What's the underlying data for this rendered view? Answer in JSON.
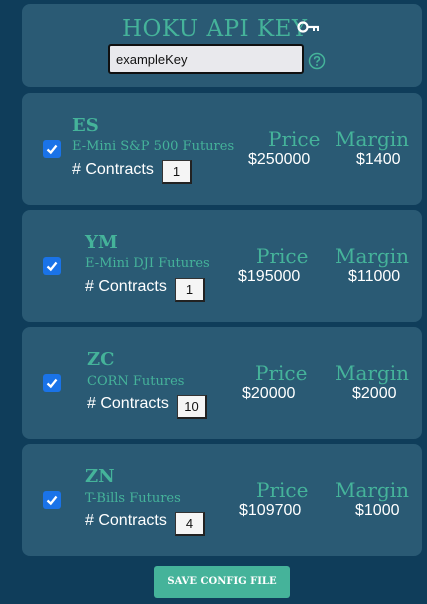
{
  "api": {
    "title": "HOKU API KEY",
    "key_value": "exampleKey",
    "key_icon": "key-icon",
    "help_icon": "help-circle-icon"
  },
  "labels": {
    "contracts": "# Contracts",
    "price": "Price",
    "margin": "Margin"
  },
  "futures": [
    {
      "checked": true,
      "ticker": "ES",
      "name": "E-Mini S&P 500 Futures",
      "contracts": "1",
      "price": "$250000",
      "margin": "$1400"
    },
    {
      "checked": true,
      "ticker": "YM",
      "name": "E-Mini DJI Futures",
      "contracts": "1",
      "price": "$195000",
      "margin": "$11000"
    },
    {
      "checked": true,
      "ticker": "ZC",
      "name": "CORN Futures",
      "contracts": "10",
      "price": "$20000",
      "margin": "$2000"
    },
    {
      "checked": true,
      "ticker": "ZN",
      "name": "T-Bills Futures",
      "contracts": "4",
      "price": "$109700",
      "margin": "$1000"
    }
  ],
  "save_label": "SAVE CONFIG FILE",
  "colors": {
    "background": "#0f3d5a",
    "panel": "#2a5a74",
    "accent": "#45b39a",
    "checkbox": "#1a73e8"
  }
}
